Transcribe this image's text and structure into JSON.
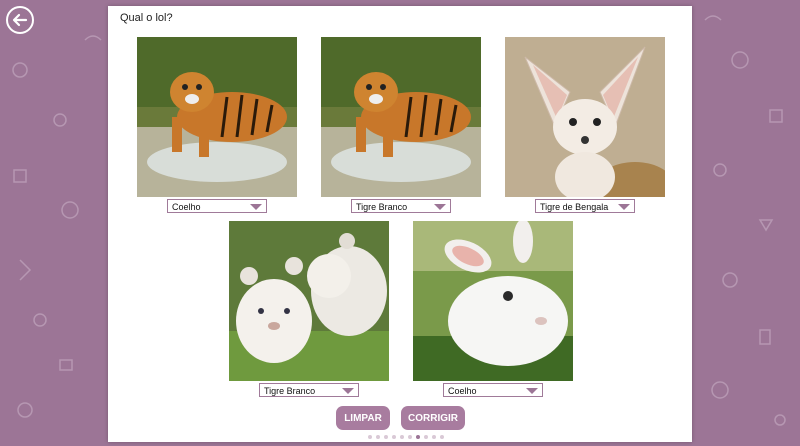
{
  "question": "Qual o lol?",
  "cards": [
    {
      "image": "tiger-icon",
      "selected": "Coelho"
    },
    {
      "image": "tiger-icon",
      "selected": "Tigre Branco"
    },
    {
      "image": "fennec-fox-icon",
      "selected": "Tigre de Bengala"
    },
    {
      "image": "white-lion-cubs-icon",
      "selected": "Tigre Branco"
    },
    {
      "image": "rabbit-icon",
      "selected": "Coelho"
    }
  ],
  "buttons": {
    "clear": "LIMPAR",
    "check": "CORRIGIR"
  },
  "pagination": {
    "total": 10,
    "current": 7
  },
  "colors": {
    "background": "#9c7596",
    "accent": "#a87c9f"
  }
}
